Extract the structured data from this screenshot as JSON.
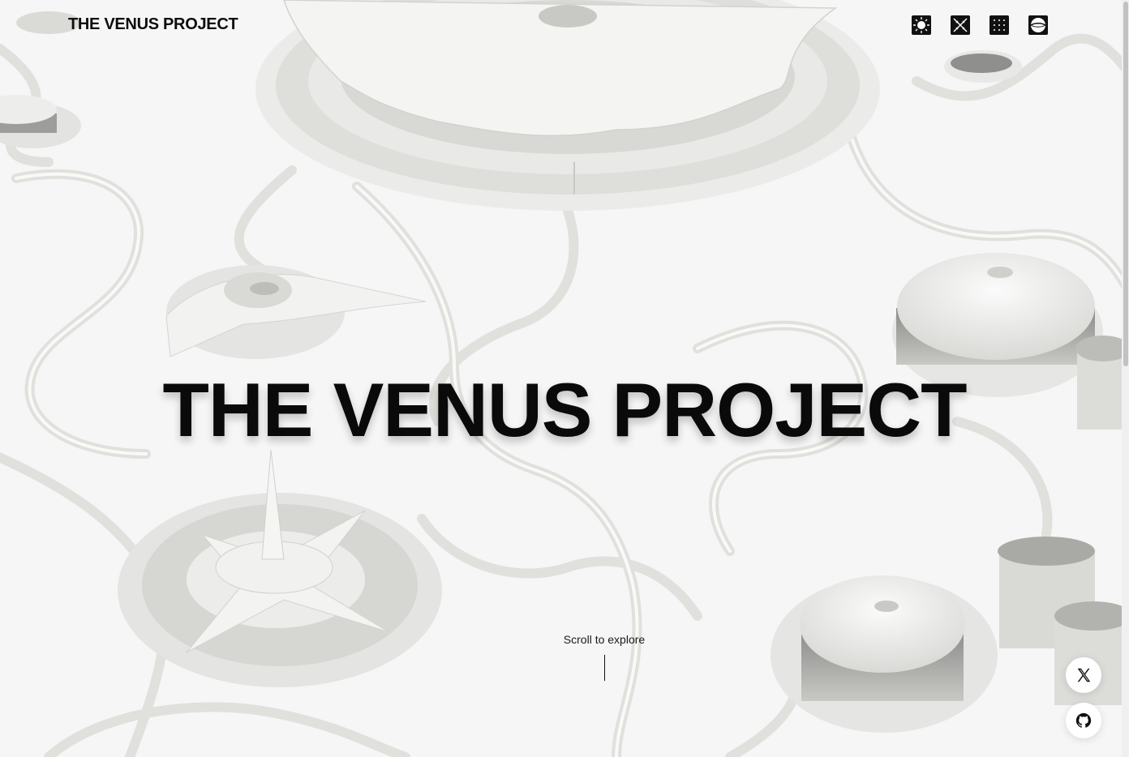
{
  "header": {
    "brand": "THE VENUS PROJECT",
    "nav_icons": [
      "sun-icon",
      "dna-icon",
      "grid-dots-icon",
      "globe-icon"
    ]
  },
  "hero": {
    "title": "THE VENUS PROJECT",
    "scroll_label": "Scroll to explore"
  },
  "social": {
    "icons": [
      "x-logo-icon",
      "github-icon"
    ]
  },
  "colors": {
    "background": "#f6f6f6",
    "ink": "#0a0a0a",
    "road": "#e2e2e0"
  }
}
